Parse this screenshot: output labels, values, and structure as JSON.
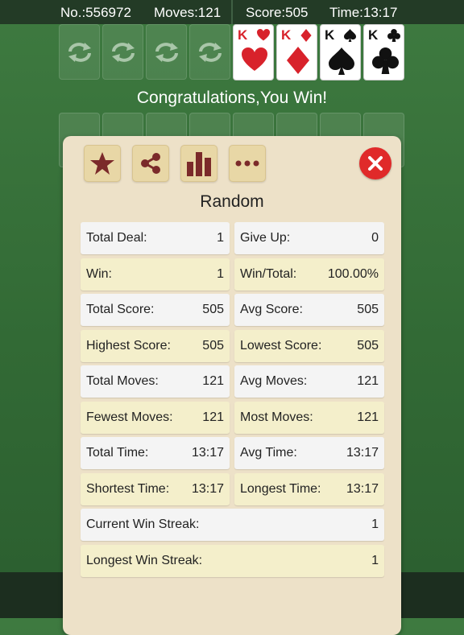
{
  "topbar": {
    "number": "No.:556972",
    "moves": "Moves:121",
    "score": "Score:505",
    "time": "Time:13:17"
  },
  "foundations": [
    {
      "icon": "recycle-icon"
    },
    {
      "icon": "recycle-icon"
    },
    {
      "icon": "recycle-icon"
    },
    {
      "icon": "recycle-icon"
    }
  ],
  "cards": [
    {
      "rank": "K",
      "suit": "hearts",
      "glyph": "♥",
      "color": "#d8222b"
    },
    {
      "rank": "K",
      "suit": "diamonds",
      "glyph": "♦",
      "color": "#d8222b"
    },
    {
      "rank": "K",
      "suit": "spades",
      "glyph": "♠",
      "color": "#111111"
    },
    {
      "rank": "K",
      "suit": "clubs",
      "glyph": "♣",
      "color": "#111111"
    }
  ],
  "message": "Congratulations,You Win!",
  "dialog": {
    "toolbar": [
      {
        "icon": "star-icon"
      },
      {
        "icon": "share-icon"
      },
      {
        "icon": "bar-chart-icon"
      },
      {
        "icon": "more-icon"
      }
    ],
    "close_icon": "close-icon",
    "mode": "Random",
    "rows": [
      [
        {
          "label": "Total Deal:",
          "value": "1"
        },
        {
          "label": "Give Up:",
          "value": "0"
        }
      ],
      [
        {
          "label": "Win:",
          "value": "1"
        },
        {
          "label": "Win/Total:",
          "value": "100.00%"
        }
      ],
      [
        {
          "label": "Total Score:",
          "value": "505"
        },
        {
          "label": "Avg Score:",
          "value": "505"
        }
      ],
      [
        {
          "label": "Highest Score:",
          "value": "505"
        },
        {
          "label": "Lowest Score:",
          "value": "505"
        }
      ],
      [
        {
          "label": "Total Moves:",
          "value": "121"
        },
        {
          "label": "Avg Moves:",
          "value": "121"
        }
      ],
      [
        {
          "label": "Fewest Moves:",
          "value": "121"
        },
        {
          "label": "Most Moves:",
          "value": "121"
        }
      ],
      [
        {
          "label": "Total Time:",
          "value": "13:17"
        },
        {
          "label": "Avg Time:",
          "value": "13:17"
        }
      ],
      [
        {
          "label": "Shortest Time:",
          "value": "13:17"
        },
        {
          "label": "Longest Time:",
          "value": "13:17"
        }
      ]
    ],
    "wide_rows": [
      {
        "label": "Current Win Streak:",
        "value": "1"
      },
      {
        "label": "Longest Win Streak:",
        "value": "1"
      }
    ]
  },
  "colors": {
    "felt": "#3e7a40",
    "panel": "#ede1c8",
    "button": "#e8d7a6",
    "icon": "#7b2a2a",
    "close": "#e02a2a"
  }
}
